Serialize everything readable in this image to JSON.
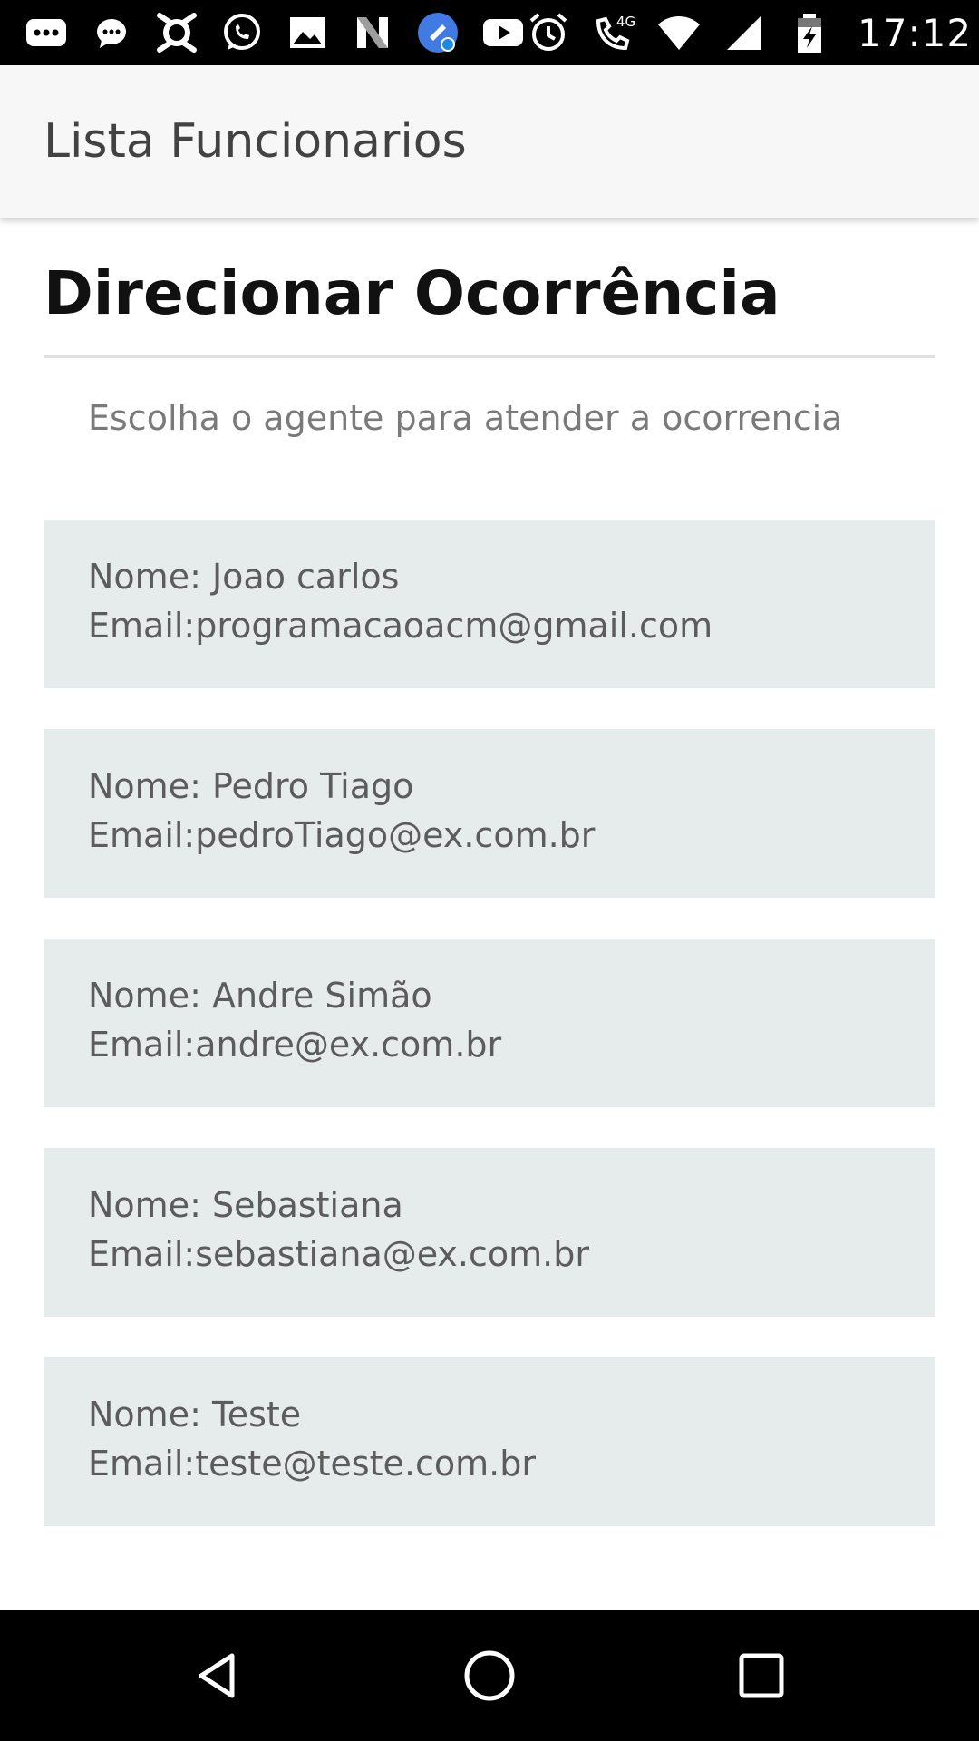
{
  "status_bar": {
    "time": "17:12",
    "network_label": "4G",
    "left_icons": [
      "chat-bubble-icon",
      "messenger-icon",
      "app-icon",
      "whatsapp-icon",
      "image-icon",
      "n-app-icon",
      "clean-app-icon",
      "youtube-icon"
    ],
    "right_icons": [
      "alarm-icon",
      "call-4g-icon",
      "wifi-icon",
      "signal-icon",
      "battery-charging-icon"
    ]
  },
  "app_bar": {
    "title": "Lista Funcionarios"
  },
  "page": {
    "heading": "Direcionar Ocorrência",
    "instruction": "Escolha o agente para atender a ocorrencia"
  },
  "agents": [
    {
      "name": "Nome: Joao carlos",
      "email": "Email:programacaoacm@gmail.com"
    },
    {
      "name": "Nome: Pedro Tiago",
      "email": "Email:pedroTiago@ex.com.br"
    },
    {
      "name": "Nome: Andre Simão",
      "email": "Email:andre@ex.com.br"
    },
    {
      "name": "Nome: Sebastiana",
      "email": "Email:sebastiana@ex.com.br"
    },
    {
      "name": "Nome: Teste",
      "email": "Email:teste@teste.com.br"
    }
  ],
  "colors": {
    "status_bar": "#000000",
    "app_bar": "#f7f7f7",
    "card_background": "#e6ebeb",
    "heading_text": "#111111",
    "body_text": "#5c5c5c",
    "nav_bar": "#000000"
  },
  "nav_bar": {
    "icons": [
      "back-icon",
      "home-icon",
      "recents-icon"
    ]
  }
}
